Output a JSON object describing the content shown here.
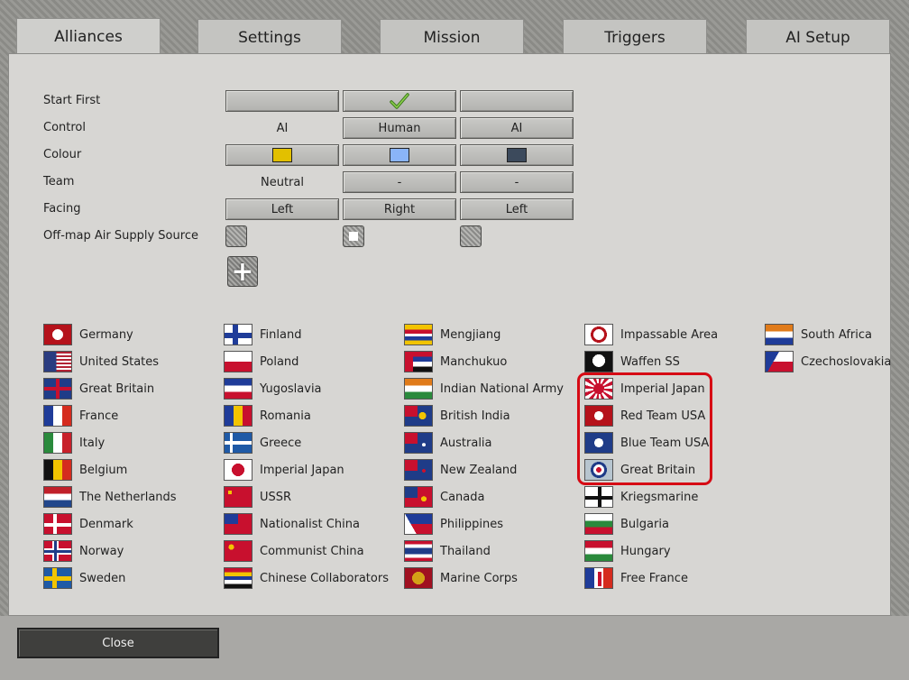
{
  "tabs": [
    {
      "label": "Alliances"
    },
    {
      "label": "Settings"
    },
    {
      "label": "Mission"
    },
    {
      "label": "Triggers"
    },
    {
      "label": "AI Setup"
    }
  ],
  "settings": {
    "labels": {
      "start_first": "Start First",
      "control": "Control",
      "colour": "Colour",
      "team": "Team",
      "facing": "Facing",
      "airsupply": "Off-map Air Supply Source"
    },
    "columns": [
      {
        "start_first": "",
        "control": "AI",
        "colour": "#e2c000",
        "team": "Neutral",
        "facing": "Left"
      },
      {
        "start_first": "✓",
        "control": "Human",
        "colour": "#8ab4f8",
        "team": "-",
        "facing": "Right"
      },
      {
        "start_first": "",
        "control": "AI",
        "colour": "#3c4a5c",
        "team": "-",
        "facing": "Left"
      }
    ]
  },
  "flags": [
    [
      {
        "label": "Germany",
        "icon": "germany-flag-icon"
      },
      {
        "label": "United States",
        "icon": "usa-flag-icon"
      },
      {
        "label": "Great Britain",
        "icon": "uk-flag-icon"
      },
      {
        "label": "France",
        "icon": "france-flag-icon"
      },
      {
        "label": "Italy",
        "icon": "italy-flag-icon"
      },
      {
        "label": "Belgium",
        "icon": "belgium-flag-icon"
      },
      {
        "label": "The Netherlands",
        "icon": "netherlands-flag-icon"
      },
      {
        "label": "Denmark",
        "icon": "denmark-flag-icon"
      },
      {
        "label": "Norway",
        "icon": "norway-flag-icon"
      },
      {
        "label": "Sweden",
        "icon": "sweden-flag-icon"
      }
    ],
    [
      {
        "label": "Finland",
        "icon": "finland-flag-icon"
      },
      {
        "label": "Poland",
        "icon": "poland-flag-icon"
      },
      {
        "label": "Yugoslavia",
        "icon": "yugoslavia-flag-icon"
      },
      {
        "label": "Romania",
        "icon": "romania-flag-icon"
      },
      {
        "label": "Greece",
        "icon": "greece-flag-icon"
      },
      {
        "label": "Imperial Japan",
        "icon": "japan-flag-icon"
      },
      {
        "label": "USSR",
        "icon": "ussr-flag-icon"
      },
      {
        "label": "Nationalist China",
        "icon": "nationalist-china-flag-icon"
      },
      {
        "label": "Communist China",
        "icon": "communist-china-flag-icon"
      },
      {
        "label": "Chinese Collaborators",
        "icon": "chinese-collaborators-flag-icon"
      }
    ],
    [
      {
        "label": "Mengjiang",
        "icon": "mengjiang-flag-icon"
      },
      {
        "label": "Manchukuo",
        "icon": "manchukuo-flag-icon"
      },
      {
        "label": "Indian National Army",
        "icon": "ina-flag-icon"
      },
      {
        "label": "British India",
        "icon": "british-india-flag-icon"
      },
      {
        "label": "Australia",
        "icon": "australia-flag-icon"
      },
      {
        "label": "New Zealand",
        "icon": "new-zealand-flag-icon"
      },
      {
        "label": "Canada",
        "icon": "canada-flag-icon"
      },
      {
        "label": "Philippines",
        "icon": "philippines-flag-icon"
      },
      {
        "label": "Thailand",
        "icon": "thailand-flag-icon"
      },
      {
        "label": "Marine Corps",
        "icon": "marine-corps-flag-icon"
      }
    ],
    [
      {
        "label": "Impassable Area",
        "icon": "impassable-icon"
      },
      {
        "label": "Waffen SS",
        "icon": "skull-icon"
      },
      {
        "label": "Imperial Japan",
        "icon": "rising-sun-icon"
      },
      {
        "label": "Red Team USA",
        "icon": "red-star-icon"
      },
      {
        "label": "Blue Team USA",
        "icon": "blue-star-icon"
      },
      {
        "label": "Great Britain",
        "icon": "roundel-icon"
      },
      {
        "label": "Kriegsmarine",
        "icon": "kriegsmarine-flag-icon"
      },
      {
        "label": "Bulgaria",
        "icon": "bulgaria-flag-icon"
      },
      {
        "label": "Hungary",
        "icon": "hungary-flag-icon"
      },
      {
        "label": "Free France",
        "icon": "free-france-flag-icon"
      }
    ],
    [
      {
        "label": "South Africa",
        "icon": "south-africa-flag-icon"
      },
      {
        "label": "Czechoslovakia",
        "icon": "czechoslovakia-flag-icon"
      }
    ]
  ],
  "close_label": "Close"
}
